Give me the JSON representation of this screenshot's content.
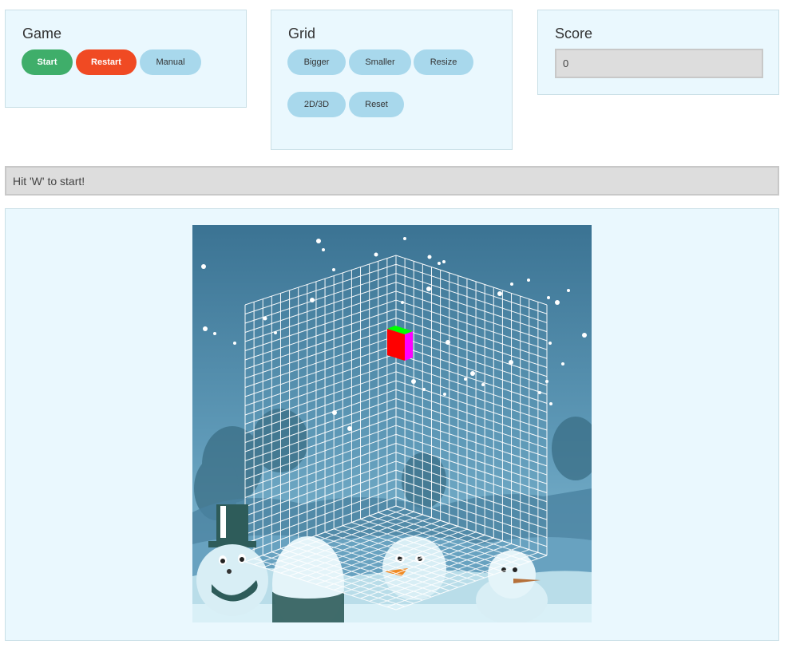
{
  "game": {
    "heading": "Game",
    "buttons": {
      "start": "Start",
      "restart": "Restart",
      "manual": "Manual"
    }
  },
  "grid": {
    "heading": "Grid",
    "buttons": {
      "bigger": "Bigger",
      "smaller": "Smaller",
      "resize": "Resize",
      "toggle_view": "2D/3D",
      "reset": "Reset"
    }
  },
  "score": {
    "heading": "Score",
    "value": "0"
  },
  "status": {
    "message": "Hit 'W' to start!"
  },
  "colors": {
    "panel_bg": "#eaf8fe",
    "start": "#3fae6a",
    "restart": "#f04a23",
    "secondary_button": "#a8d8ec",
    "cube_front": "#ff0000",
    "cube_side": "#ff00ff",
    "cube_top": "#00ff00"
  },
  "board": {
    "scene": "winter snowmen background",
    "icons": [
      "snowman-top-hat-icon",
      "snowman-carrot-icon",
      "snowman-small-icon",
      "snowflake-icon"
    ]
  }
}
